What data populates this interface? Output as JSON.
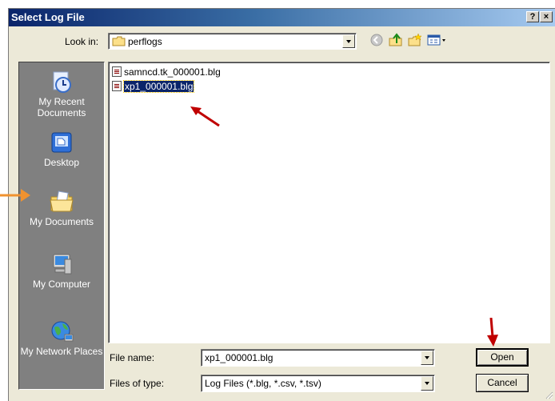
{
  "window": {
    "title": "Select Log File",
    "help_label": "?",
    "close_label": "×"
  },
  "toolbar": {
    "look_in_label": "Look in:",
    "look_in_value": "perflogs",
    "tools": [
      "back-icon",
      "up-folder-icon",
      "new-folder-icon",
      "views-menu-icon"
    ]
  },
  "places": [
    {
      "label": "My Recent Documents",
      "icon": "recent-documents-icon"
    },
    {
      "label": "Desktop",
      "icon": "desktop-icon"
    },
    {
      "label": "My Documents",
      "icon": "my-documents-icon"
    },
    {
      "label": "My Computer",
      "icon": "my-computer-icon"
    },
    {
      "label": "My Network Places",
      "icon": "network-places-icon"
    }
  ],
  "files": [
    {
      "name": "samncd.tk_000001.blg",
      "selected": false
    },
    {
      "name": "xp1_000001.blg",
      "selected": true
    }
  ],
  "file_name": {
    "label": "File name:",
    "value": "xp1_000001.blg"
  },
  "file_type": {
    "label": "Files of type:",
    "value": "Log Files (*.blg, *.csv, *.tsv)"
  },
  "buttons": {
    "open": "Open",
    "cancel": "Cancel"
  },
  "colors": {
    "annotation_red": "#c00000",
    "annotation_orange": "#f0922f",
    "selection": "#0a246a"
  }
}
